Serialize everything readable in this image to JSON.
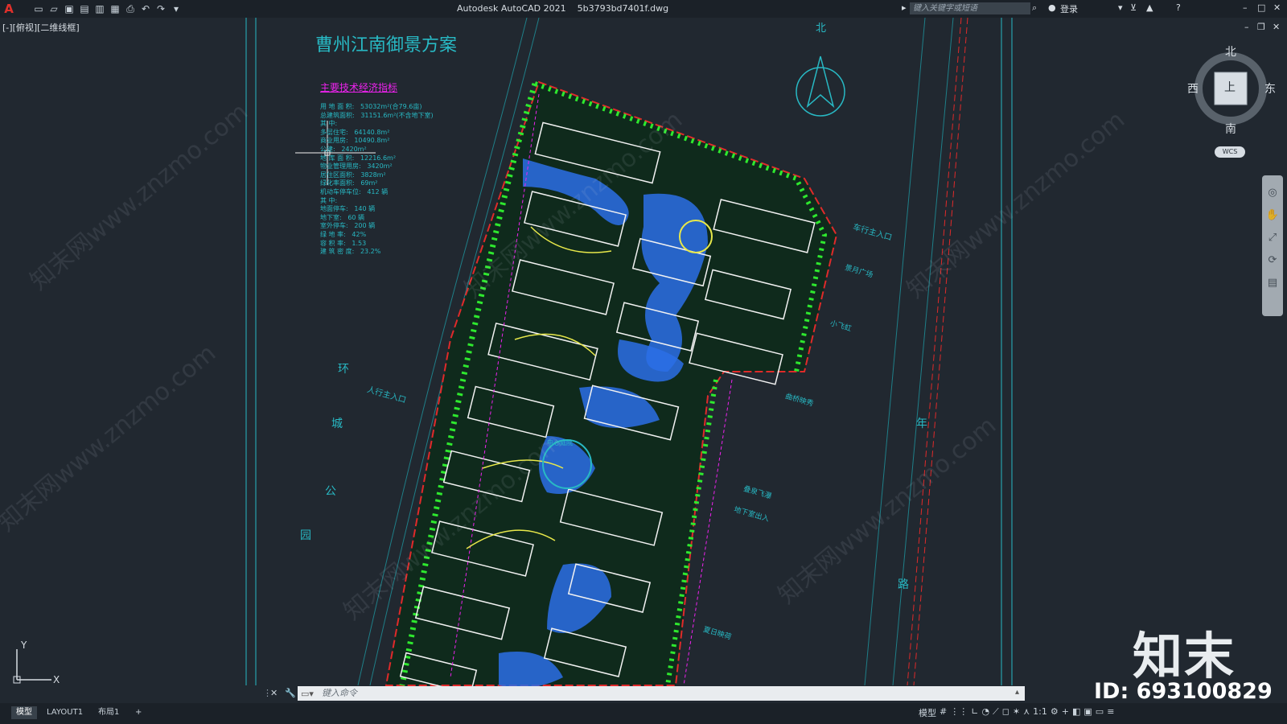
{
  "app": {
    "title": "Autodesk AutoCAD 2021",
    "filename": "5b3793bd7401f.dwg",
    "search_placeholder": "键入关键字或短语",
    "login_label": "登录"
  },
  "viewport": {
    "label": "[-][俯视][二维线框]"
  },
  "drawing": {
    "title": "曹州江南御景方案",
    "table_heading": "主要技术经济指标",
    "table_rows": [
      "用 地 面 积:   53032m²(合79.6亩)",
      "总建筑面积:   31151.6m²(不含地下室)",
      "其 中:",
      "多层住宅:   64140.8m²",
      "商业用房:   10490.8m²",
      "公建:   2420m²",
      "地 库 面 积:   12216.6m²",
      "物业管理用房:   3420m²",
      "居住区面积:   3828m²",
      "绿化率面积:   69m²",
      "机动车停车位:   412 辆",
      "其 中:",
      "地面停车:   140 辆",
      "地下室:   60 辆",
      "室外停车:   200 辆",
      "绿 地 率:   42%",
      "容 积 率:   1.53",
      "建 筑 密 度:   23.2%"
    ],
    "labels": {
      "north": "北",
      "road_west": [
        "环",
        "城",
        "公",
        "园"
      ],
      "road_east": [
        "年",
        "路"
      ],
      "car_entrance": "车行主入口",
      "pedestrian_entrance": "人行主入口",
      "plaza": "景月广场",
      "pavilion": "小飞虹",
      "bridge": "曲桥映秀",
      "fountain": "叠泉飞瀑",
      "garden": "夏日映荷",
      "underground": "地下室出入",
      "courtyard": "中心庭院"
    }
  },
  "navcube": {
    "north": "北",
    "south": "南",
    "west": "西",
    "east": "东",
    "face": "上",
    "wcs": "WCS"
  },
  "command": {
    "placeholder": "键入命令"
  },
  "layout_tabs": [
    "模型",
    "LAYOUT1",
    "布局1",
    "+"
  ],
  "status": {
    "model": "模型",
    "scale": "1:1"
  },
  "branding": {
    "logo": "知末",
    "id": "ID: 693100829",
    "watermark": "知末网www.znzmo.com"
  },
  "ucs": {
    "x": "X",
    "y": "Y"
  },
  "colors": {
    "background": "#212830",
    "cyan": "#28b9c4",
    "green": "#2ee82e",
    "magenta": "#ee22ee",
    "white": "#f2f2f2",
    "blue": "#2c6ee6",
    "yellow": "#e8e84a"
  }
}
